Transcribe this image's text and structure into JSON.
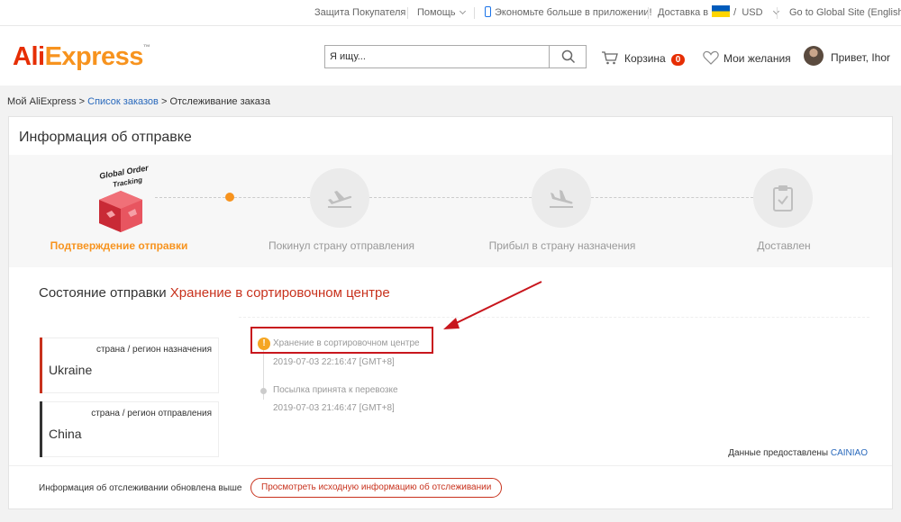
{
  "topbar": {
    "buyer_protection": "Защита Покупателя",
    "help": "Помощь",
    "app_promo": "Экономьте больше в приложении!",
    "ship_to": "Доставка в",
    "currency_sep": "/",
    "currency": "USD",
    "global_site": "Go to Global Site (English)"
  },
  "header": {
    "logo_part1": "Ali",
    "logo_part2": "Express",
    "logo_tm": "™",
    "search_placeholder": "Я ищу...",
    "cart_label": "Корзина",
    "cart_count": "0",
    "wishlist_label": "Мои желания",
    "greeting": "Привет, Ihor"
  },
  "breadcrumb": {
    "root": "Мой AliExpress",
    "sep": ">",
    "orders": "Список заказов",
    "current": "Отслеживание заказа"
  },
  "shipping": {
    "title": "Информация об отправке",
    "badge_title": "Global Order",
    "badge_subtitle": "Tracking",
    "steps": [
      {
        "label": "Подтверждение отправки",
        "icon": "box-icon",
        "active": true
      },
      {
        "label": "Покинул страну отправления",
        "icon": "plane-departure-icon",
        "active": false
      },
      {
        "label": "Прибыл в страну назначения",
        "icon": "plane-arrival-icon",
        "active": false
      },
      {
        "label": "Доставлен",
        "icon": "clipboard-check-icon",
        "active": false
      }
    ],
    "status_label": "Состояние отправки",
    "status_value": "Хранение в сортировочном центре",
    "destination": {
      "label": "страна / регион назначения",
      "country": "Ukraine"
    },
    "origin": {
      "label": "страна / регион отправления",
      "country": "China"
    },
    "events": [
      {
        "text": "Хранение в сортировочном центре",
        "time": "2019-07-03 22:16:47 [GMT+8]"
      },
      {
        "text": "Посылка принята к перевозке",
        "time": "2019-07-03 21:46:47 [GMT+8]"
      }
    ],
    "provider_label": "Данные предоставлены",
    "provider_name": "CAINIAO",
    "update_note": "Информация об отслеживании обновлена выше",
    "view_original_button": "Просмотреть исходную информацию об отслеживании"
  },
  "colors": {
    "accent_orange": "#f7931e",
    "brand_red": "#e62e04",
    "status_red": "#c8321d",
    "destination_bar": "#c8321d",
    "origin_bar": "#333333",
    "link_blue": "#2969bc"
  }
}
